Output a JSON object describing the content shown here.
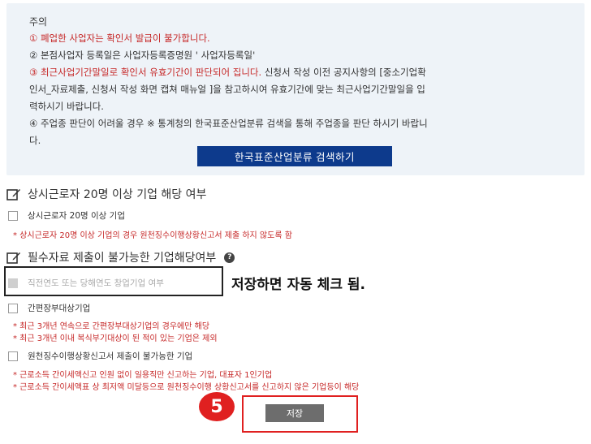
{
  "notice": {
    "title": "주의",
    "lines": [
      {
        "text": "① 폐업한 사업자는 확인서 발급이 불가합니다.",
        "color": "red"
      },
      {
        "text": "② 본점사업자 등록일은 사업자등록증명원 ' 사업자등록일'",
        "color": "dark"
      },
      {
        "text": "③ 최근사업기간말일로 확인서 유효기간이 판단되어 집니다.",
        "color": "red",
        "text_cont": " 신청서 작성 이전 공지사항의 [중소기업확"
      },
      {
        "text": "인서_자료제출, 신청서 작성 화면 캡쳐 매뉴얼 ]을 참고하시여 유효기간에 맞는 최근사업기간말일을 입",
        "color": "dark"
      },
      {
        "text": "력하시기 바랍니다.",
        "color": "dark"
      },
      {
        "text": "④ 주업종 판단이 어려울 경우 ※ 통계청의 한국표준산업분류 검색을 통해 주업종을 판단 하시기 바랍니",
        "color": "dark"
      },
      {
        "text": "다.",
        "color": "dark"
      }
    ],
    "search_button": "한국표준산업분류 검색하기"
  },
  "section1": {
    "title": "상시근로자 20명 이상 기업 해당 여부",
    "checkbox_label": "상시근로자 20명 이상 기업",
    "note": "* 상시근로자 20명 이상 기업의 경우 원천징수이행상황신고서 제출 하지 않도록 함"
  },
  "section2": {
    "title": "필수자료 제출이 불가능한 기업해당여부",
    "help_glyph": "?",
    "disabled_checkbox_label": "직전연도 또는 당해연도 창업기업 여부",
    "annotation": "저장하면 자동 체크 됨.",
    "checkbox2_label": "간편장부대상기업",
    "notes2": [
      "* 최근 3개년 연속으로 간편장부대상기업의 경우에만 해당",
      "* 최근 3개년 이내 복식부기대상이 된 적이 있는 기업은 제외"
    ],
    "checkbox3_label": "원천징수이행상황신고서 제출이 불가능한 기업",
    "notes3": [
      "* 근로소득 간이세액신고 인원 없이 일용직만 신고하는 기업, 대표자 1인기업",
      "* 근로소득 간이세액표 상 최저액 미달등으로 원천징수이행 상황신고서를 신고하지 않은 기업등이 해당"
    ]
  },
  "step_number": "5",
  "save_button": "저장",
  "colors": {
    "accent_blue": "#0d3a8c",
    "note_red": "#c62828",
    "annotation_red": "#e02020",
    "panel_bg": "#eef3f8"
  }
}
